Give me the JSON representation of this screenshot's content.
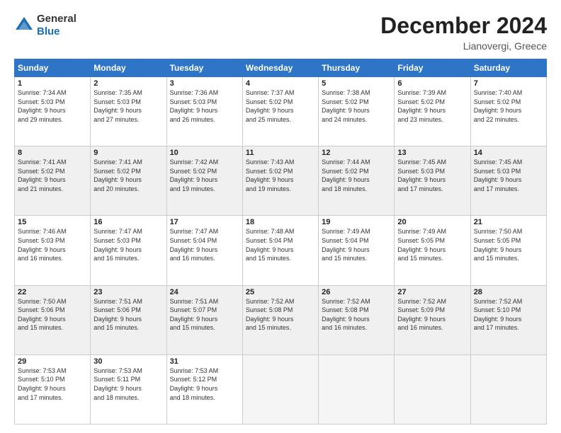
{
  "header": {
    "logo_general": "General",
    "logo_blue": "Blue",
    "title": "December 2024",
    "subtitle": "Lianovergi, Greece"
  },
  "days_of_week": [
    "Sunday",
    "Monday",
    "Tuesday",
    "Wednesday",
    "Thursday",
    "Friday",
    "Saturday"
  ],
  "weeks": [
    [
      {
        "day": "1",
        "info": "Sunrise: 7:34 AM\nSunset: 5:03 PM\nDaylight: 9 hours\nand 29 minutes."
      },
      {
        "day": "2",
        "info": "Sunrise: 7:35 AM\nSunset: 5:03 PM\nDaylight: 9 hours\nand 27 minutes."
      },
      {
        "day": "3",
        "info": "Sunrise: 7:36 AM\nSunset: 5:03 PM\nDaylight: 9 hours\nand 26 minutes."
      },
      {
        "day": "4",
        "info": "Sunrise: 7:37 AM\nSunset: 5:02 PM\nDaylight: 9 hours\nand 25 minutes."
      },
      {
        "day": "5",
        "info": "Sunrise: 7:38 AM\nSunset: 5:02 PM\nDaylight: 9 hours\nand 24 minutes."
      },
      {
        "day": "6",
        "info": "Sunrise: 7:39 AM\nSunset: 5:02 PM\nDaylight: 9 hours\nand 23 minutes."
      },
      {
        "day": "7",
        "info": "Sunrise: 7:40 AM\nSunset: 5:02 PM\nDaylight: 9 hours\nand 22 minutes."
      }
    ],
    [
      {
        "day": "8",
        "info": "Sunrise: 7:41 AM\nSunset: 5:02 PM\nDaylight: 9 hours\nand 21 minutes."
      },
      {
        "day": "9",
        "info": "Sunrise: 7:41 AM\nSunset: 5:02 PM\nDaylight: 9 hours\nand 20 minutes."
      },
      {
        "day": "10",
        "info": "Sunrise: 7:42 AM\nSunset: 5:02 PM\nDaylight: 9 hours\nand 19 minutes."
      },
      {
        "day": "11",
        "info": "Sunrise: 7:43 AM\nSunset: 5:02 PM\nDaylight: 9 hours\nand 19 minutes."
      },
      {
        "day": "12",
        "info": "Sunrise: 7:44 AM\nSunset: 5:02 PM\nDaylight: 9 hours\nand 18 minutes."
      },
      {
        "day": "13",
        "info": "Sunrise: 7:45 AM\nSunset: 5:03 PM\nDaylight: 9 hours\nand 17 minutes."
      },
      {
        "day": "14",
        "info": "Sunrise: 7:45 AM\nSunset: 5:03 PM\nDaylight: 9 hours\nand 17 minutes."
      }
    ],
    [
      {
        "day": "15",
        "info": "Sunrise: 7:46 AM\nSunset: 5:03 PM\nDaylight: 9 hours\nand 16 minutes."
      },
      {
        "day": "16",
        "info": "Sunrise: 7:47 AM\nSunset: 5:03 PM\nDaylight: 9 hours\nand 16 minutes."
      },
      {
        "day": "17",
        "info": "Sunrise: 7:47 AM\nSunset: 5:04 PM\nDaylight: 9 hours\nand 16 minutes."
      },
      {
        "day": "18",
        "info": "Sunrise: 7:48 AM\nSunset: 5:04 PM\nDaylight: 9 hours\nand 15 minutes."
      },
      {
        "day": "19",
        "info": "Sunrise: 7:49 AM\nSunset: 5:04 PM\nDaylight: 9 hours\nand 15 minutes."
      },
      {
        "day": "20",
        "info": "Sunrise: 7:49 AM\nSunset: 5:05 PM\nDaylight: 9 hours\nand 15 minutes."
      },
      {
        "day": "21",
        "info": "Sunrise: 7:50 AM\nSunset: 5:05 PM\nDaylight: 9 hours\nand 15 minutes."
      }
    ],
    [
      {
        "day": "22",
        "info": "Sunrise: 7:50 AM\nSunset: 5:06 PM\nDaylight: 9 hours\nand 15 minutes."
      },
      {
        "day": "23",
        "info": "Sunrise: 7:51 AM\nSunset: 5:06 PM\nDaylight: 9 hours\nand 15 minutes."
      },
      {
        "day": "24",
        "info": "Sunrise: 7:51 AM\nSunset: 5:07 PM\nDaylight: 9 hours\nand 15 minutes."
      },
      {
        "day": "25",
        "info": "Sunrise: 7:52 AM\nSunset: 5:08 PM\nDaylight: 9 hours\nand 15 minutes."
      },
      {
        "day": "26",
        "info": "Sunrise: 7:52 AM\nSunset: 5:08 PM\nDaylight: 9 hours\nand 16 minutes."
      },
      {
        "day": "27",
        "info": "Sunrise: 7:52 AM\nSunset: 5:09 PM\nDaylight: 9 hours\nand 16 minutes."
      },
      {
        "day": "28",
        "info": "Sunrise: 7:52 AM\nSunset: 5:10 PM\nDaylight: 9 hours\nand 17 minutes."
      }
    ],
    [
      {
        "day": "29",
        "info": "Sunrise: 7:53 AM\nSunset: 5:10 PM\nDaylight: 9 hours\nand 17 minutes."
      },
      {
        "day": "30",
        "info": "Sunrise: 7:53 AM\nSunset: 5:11 PM\nDaylight: 9 hours\nand 18 minutes."
      },
      {
        "day": "31",
        "info": "Sunrise: 7:53 AM\nSunset: 5:12 PM\nDaylight: 9 hours\nand 18 minutes."
      },
      {
        "day": "",
        "info": ""
      },
      {
        "day": "",
        "info": ""
      },
      {
        "day": "",
        "info": ""
      },
      {
        "day": "",
        "info": ""
      }
    ]
  ]
}
